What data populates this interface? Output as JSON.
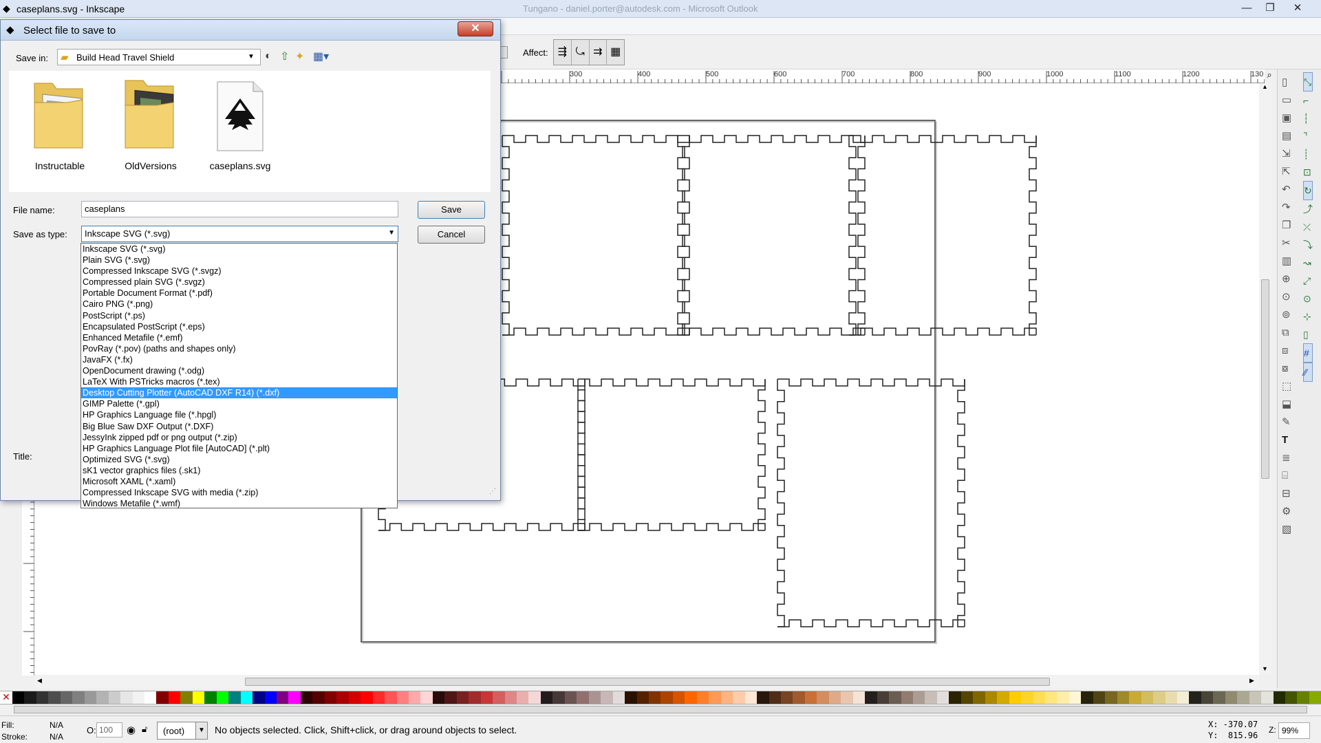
{
  "window": {
    "title": "caseplans.svg - Inkscape",
    "background_title": "Tungano - daniel.porter@autodesk.com - Microsoft Outlook",
    "min": "—",
    "max": "❐",
    "close": "✕"
  },
  "toolbar": {
    "affect_label": "Affect:"
  },
  "ruler": {
    "ticks": [
      "300",
      "400",
      "500",
      "600",
      "700",
      "800",
      "900",
      "1000",
      "1100",
      "1200",
      "130"
    ]
  },
  "dialog": {
    "title": "Select file to save to",
    "close": "✕",
    "save_in_label": "Save in:",
    "save_in_value": "Build Head Travel Shield",
    "files": [
      {
        "name": "Instructable",
        "icon": "folder-icon"
      },
      {
        "name": "OldVersions",
        "icon": "folder-icon"
      },
      {
        "name": "caseplans.svg",
        "icon": "inkscape-file-icon"
      }
    ],
    "file_name_label": "File name:",
    "file_name_value": "caseplans",
    "save_as_type_label": "Save as type:",
    "save_as_type_value": "Inkscape SVG (*.svg)",
    "title_label": "Title:",
    "save_button": "Save",
    "cancel_button": "Cancel",
    "type_options": [
      "Inkscape SVG (*.svg)",
      "Plain SVG (*.svg)",
      "Compressed Inkscape SVG (*.svgz)",
      "Compressed plain SVG (*.svgz)",
      "Portable Document Format (*.pdf)",
      "Cairo PNG (*.png)",
      "PostScript (*.ps)",
      "Encapsulated PostScript (*.eps)",
      "Enhanced Metafile (*.emf)",
      "PovRay (*.pov) (paths and shapes only)",
      "JavaFX (*.fx)",
      "OpenDocument drawing (*.odg)",
      "LaTeX With PSTricks macros (*.tex)",
      "Desktop Cutting Plotter (AutoCAD DXF R14) (*.dxf)",
      "GIMP Palette (*.gpl)",
      "HP Graphics Language file (*.hpgl)",
      "Big Blue Saw DXF Output (*.DXF)",
      "JessyInk zipped pdf or png output (*.zip)",
      "HP Graphics Language Plot file [AutoCAD] (*.plt)",
      "Optimized SVG (*.svg)",
      "sK1 vector graphics files (.sk1)",
      "Microsoft XAML (*.xaml)",
      "Compressed Inkscape SVG with media (*.zip)",
      "Windows Metafile (*.wmf)"
    ],
    "selected_option_index": 13
  },
  "status": {
    "fill_label": "Fill:",
    "fill_value": "N/A",
    "stroke_label": "Stroke:",
    "stroke_value": "N/A",
    "opacity_label": "O:",
    "opacity_value": "100",
    "layer_value": "(root)",
    "message": "No objects selected. Click, Shift+click, or drag around objects to select.",
    "x_readout": "X: -370.07",
    "y_readout": "Y:  815.96",
    "zoom_label": "Z:",
    "zoom_value": "99%"
  },
  "palette_colors": [
    "#000000",
    "#1a1a1a",
    "#333333",
    "#4d4d4d",
    "#666666",
    "#808080",
    "#999999",
    "#b3b3b3",
    "#cccccc",
    "#e6e6e6",
    "#f2f2f2",
    "#ffffff",
    "#800000",
    "#ff0000",
    "#808000",
    "#ffff00",
    "#008000",
    "#00ff00",
    "#008080",
    "#00ffff",
    "#000080",
    "#0000ff",
    "#800080",
    "#ff00ff",
    "#2b0000",
    "#550000",
    "#800000",
    "#aa0000",
    "#d40000",
    "#ff0000",
    "#ff2a2a",
    "#ff5555",
    "#ff8080",
    "#ffaaaa",
    "#ffd5d5",
    "#280b0b",
    "#501616",
    "#782121",
    "#a02c2c",
    "#c83737",
    "#d35f5f",
    "#de8787",
    "#e9afaf",
    "#f4d7d7",
    "#241c1c",
    "#483737",
    "#6c5353",
    "#916f6f",
    "#ac9393",
    "#c8b7b7",
    "#e3dbdb",
    "#2b1100",
    "#552200",
    "#803300",
    "#aa4400",
    "#d45500",
    "#ff6600",
    "#ff7f2a",
    "#ff9955",
    "#ffb380",
    "#ffccaa",
    "#ffe6d5",
    "#28170b",
    "#502d16",
    "#784421",
    "#a05a2c",
    "#c87137",
    "#d38d5f",
    "#deaa87",
    "#e9c6af",
    "#f4e3d7",
    "#241f1c",
    "#483e37",
    "#6c5d53",
    "#917c6f",
    "#ac9d93",
    "#c8beb7",
    "#e3dedb",
    "#2b2200",
    "#554400",
    "#806600",
    "#aa8800",
    "#d4aa00",
    "#ffcc00",
    "#ffd42a",
    "#ffdd55",
    "#ffe680",
    "#ffeeaa",
    "#fff6d5",
    "#28220b",
    "#504416",
    "#786721",
    "#a0892c",
    "#c8ab37",
    "#d3bc5f",
    "#decd87",
    "#e9ddaf",
    "#f4eed7",
    "#24221c",
    "#484537",
    "#6c6753",
    "#918a6f",
    "#aca793",
    "#c8c4b7",
    "#e3e2db",
    "#222b00",
    "#445500",
    "#668000",
    "#88aa00"
  ]
}
